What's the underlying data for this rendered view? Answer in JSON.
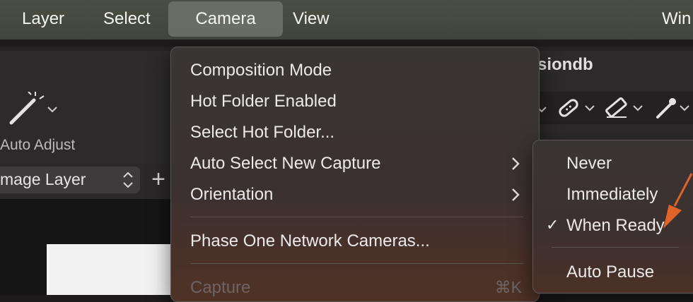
{
  "menubar": {
    "items": [
      {
        "label": "Layer"
      },
      {
        "label": "Select"
      },
      {
        "label": "Camera",
        "active": true
      },
      {
        "label": "View"
      },
      {
        "label": "Win"
      }
    ]
  },
  "app": {
    "window_title": "siondb",
    "auto_adjust_label": "Auto Adjust",
    "layer_select_value": "mage Layer",
    "add_layer_symbol": "+"
  },
  "camera_menu": {
    "items": [
      {
        "label": "Composition Mode"
      },
      {
        "label": "Hot Folder Enabled"
      },
      {
        "label": "Select Hot Folder..."
      },
      {
        "label": "Auto Select New Capture",
        "submenu": true
      },
      {
        "label": "Orientation",
        "submenu": true
      },
      {
        "label": "Phase One Network Cameras..."
      },
      {
        "label": "Capture",
        "disabled": true,
        "shortcut": "⌘K"
      }
    ]
  },
  "auto_select_submenu": {
    "items": [
      {
        "label": "Never"
      },
      {
        "label": "Immediately"
      },
      {
        "label": "When Ready",
        "checked": true
      },
      {
        "label": "Auto Pause"
      }
    ],
    "check_glyph": "✓"
  },
  "colors": {
    "menubar_bg": "#474a40",
    "active_menu_bg": "#6a6d63",
    "menu_bg": "#3a3333",
    "annotation_arrow": "#e0632a"
  },
  "icons": [
    "magic-wand-icon",
    "chevron-down-icon",
    "bandage-icon",
    "eraser-icon",
    "eyedropper-icon",
    "chevron-right-icon",
    "updown-chevron-icon"
  ]
}
